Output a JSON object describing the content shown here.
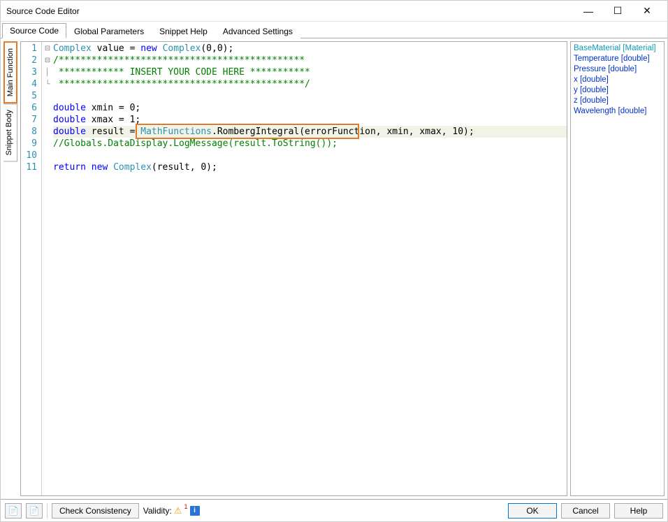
{
  "window": {
    "title": "Source Code Editor"
  },
  "tabs": {
    "items": [
      "Source Code",
      "Global Parameters",
      "Snippet Help",
      "Advanced Settings"
    ],
    "active": 0
  },
  "vtabs": {
    "top": "Main Function",
    "bottom": "Snippet Body"
  },
  "gutter_lines": [
    "1",
    "2",
    "3",
    "4",
    "5",
    "6",
    "7",
    "8",
    "9",
    "10",
    "11"
  ],
  "code": {
    "l1": {
      "a": "Complex",
      "b": " value = ",
      "c": "new",
      "d": " ",
      "e": "Complex",
      "f": "(0,0);"
    },
    "l2": "/*********************************************",
    "l3": " ************ INSERT YOUR CODE HERE ***********",
    "l4": " *********************************************/",
    "l5": "",
    "l6": {
      "a": "double",
      "b": " xmin = 0;"
    },
    "l7": {
      "a": "double",
      "b": " xmax = 1;"
    },
    "l8": {
      "a": "double",
      "b": " result = ",
      "c": "MathFunctions",
      "d": ".RombergIntegral(errorFunction, xmin, xmax, 10);"
    },
    "l9": "//Globals.DataDisplay.LogMessage(result.ToString());",
    "l10": "",
    "l11": {
      "a": "return",
      "b": " ",
      "c": "new",
      "d": " ",
      "e": "Complex",
      "f": "(result, 0);"
    }
  },
  "side_items": [
    {
      "label": "BaseMaterial [Material]",
      "cls": "mat"
    },
    {
      "label": "Temperature [double]",
      "cls": "dbl"
    },
    {
      "label": "Pressure [double]",
      "cls": "dbl"
    },
    {
      "label": "x [double]",
      "cls": "dbl"
    },
    {
      "label": "y [double]",
      "cls": "dbl"
    },
    {
      "label": "z [double]",
      "cls": "dbl"
    },
    {
      "label": "Wavelength [double]",
      "cls": "dbl"
    }
  ],
  "bottom": {
    "check": "Check Consistency",
    "validity_label": "Validity:",
    "warn_count": "1",
    "ok": "OK",
    "cancel": "Cancel",
    "help": "Help"
  }
}
